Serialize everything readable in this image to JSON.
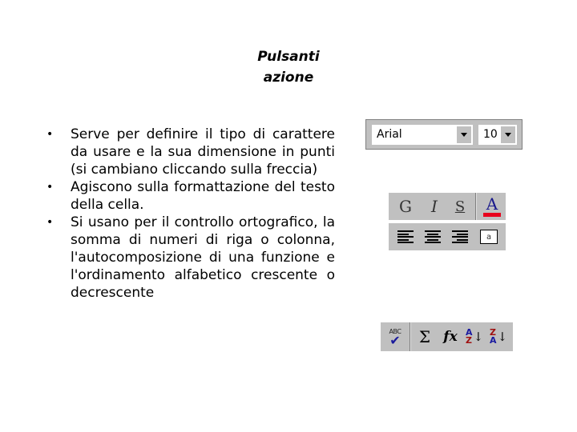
{
  "title": {
    "line1": "Pulsanti",
    "line2": "azione"
  },
  "bullets": [
    "Serve per definire il tipo di carattere da usare e la sua dimensione in punti (si cambiano cliccando sulla freccia)",
    "Agiscono sulla formattazione del testo della cella.",
    "Si usano per il controllo ortografico, la somma di numeri di riga o colonna, l'autocomposizione di una funzione e l'ordinamento alfabetico crescente o decrescente"
  ],
  "font_toolbar": {
    "font_name": "Arial",
    "font_size": "10"
  },
  "format_toolbar": {
    "bold_label": "G",
    "italic_label": "I",
    "underline_label": "S",
    "font_color_label": "A",
    "font_color": "#e8001c"
  },
  "alignment_toolbar": {
    "merge_label": "a"
  },
  "tools_toolbar": {
    "spelling_label": "ABC",
    "spelling_check": "✔",
    "autosum_label": "Σ",
    "function_label": "fx",
    "sort_asc_top": "A",
    "sort_asc_bottom": "Z",
    "sort_desc_top": "Z",
    "sort_desc_bottom": "A",
    "sort_arrow": "↓"
  }
}
